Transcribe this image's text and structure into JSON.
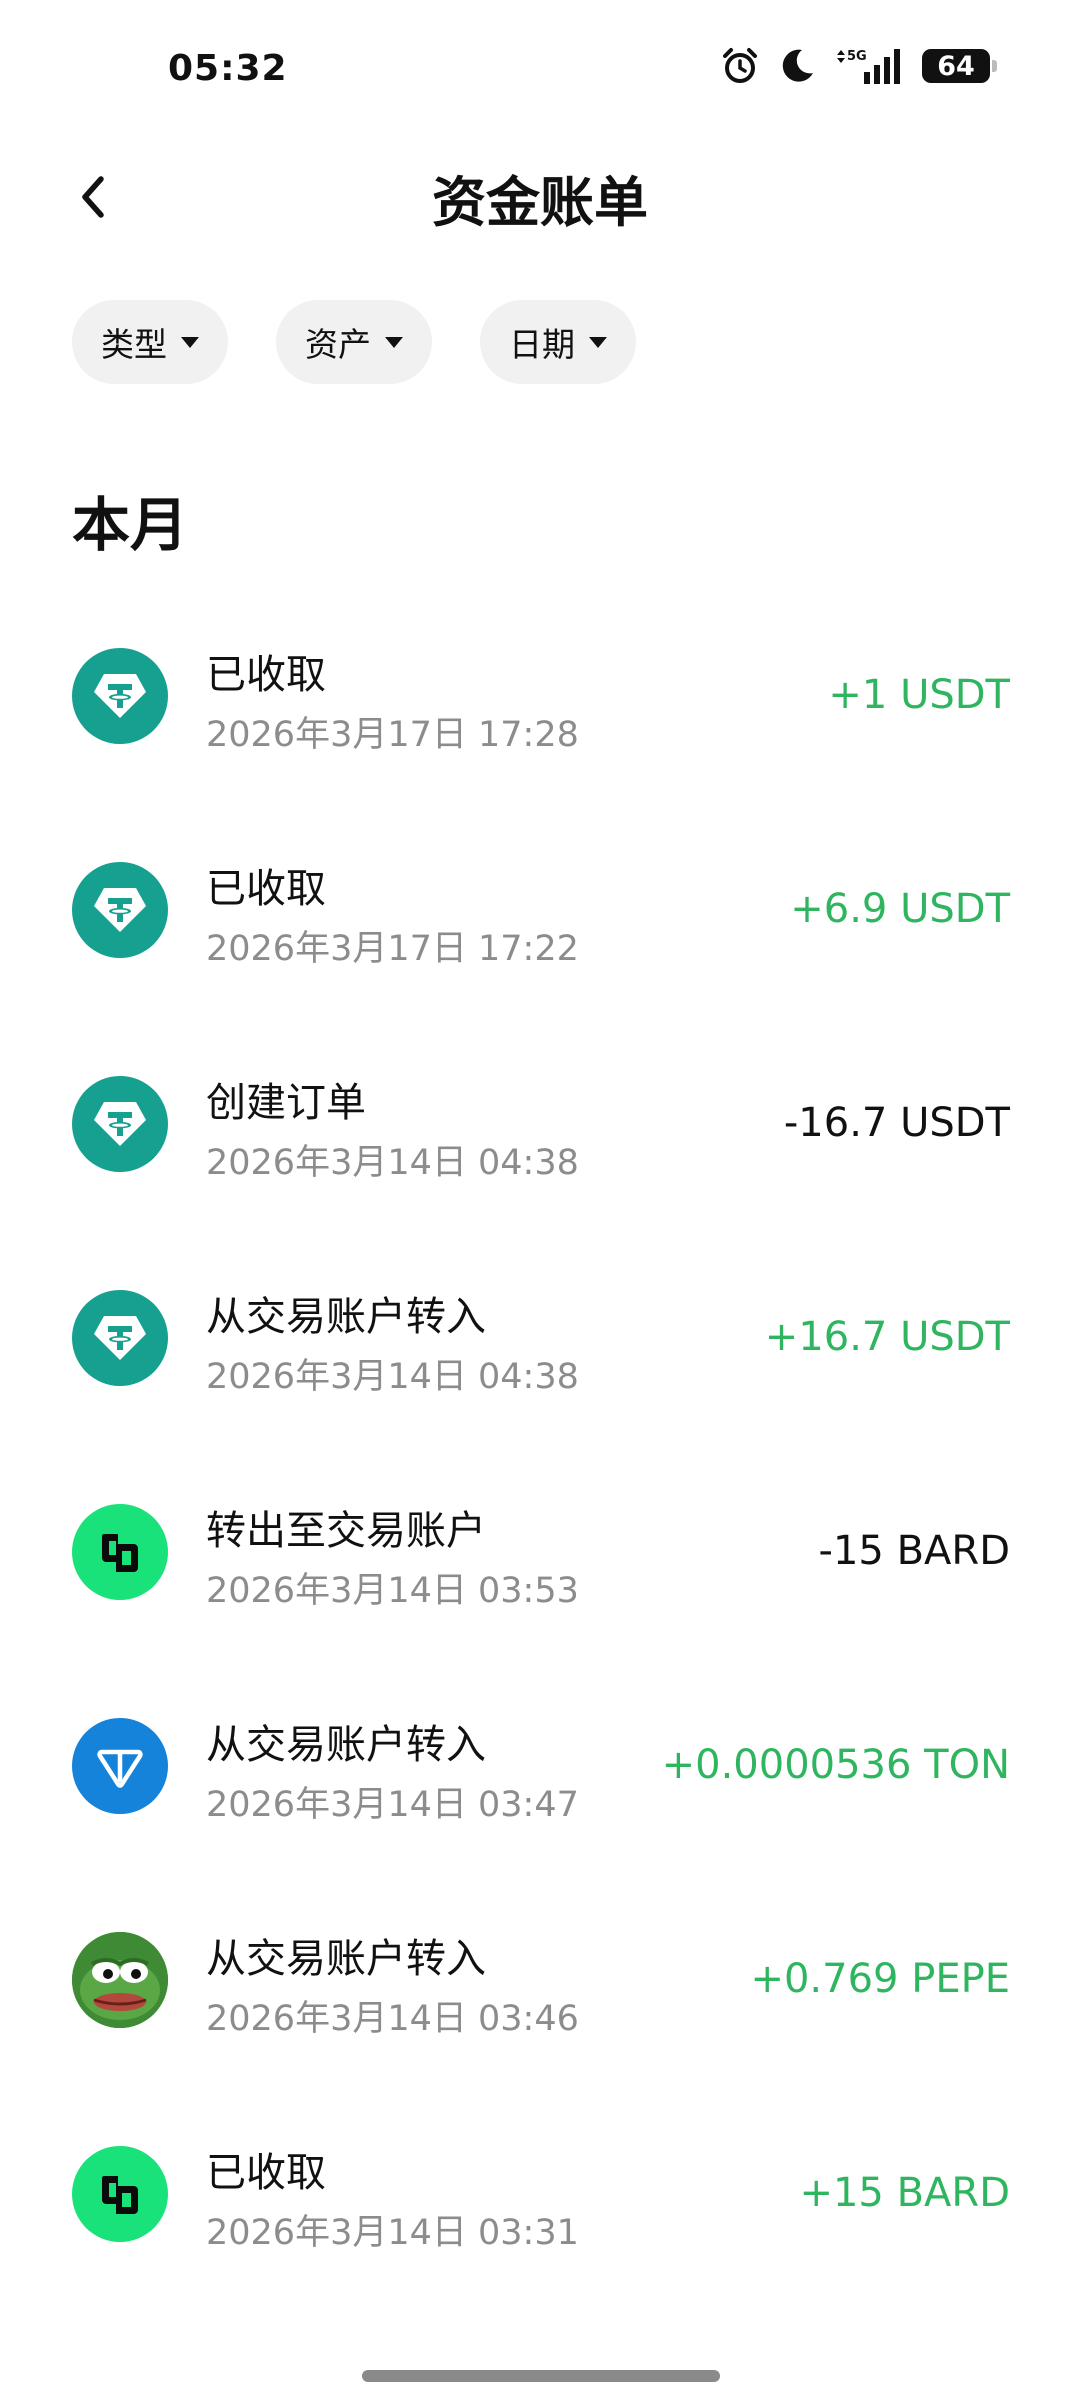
{
  "status": {
    "time": "05:32",
    "network": "5G",
    "battery": "64"
  },
  "header": {
    "title": "资金账单"
  },
  "filters": [
    {
      "label": "类型"
    },
    {
      "label": "资产"
    },
    {
      "label": "日期"
    }
  ],
  "section": {
    "title": "本月"
  },
  "transactions": [
    {
      "title": "已收取",
      "time": "2026年3月17日 17:28",
      "amount": "+1 USDT",
      "direction": "in",
      "icon": "usdt-icon"
    },
    {
      "title": "已收取",
      "time": "2026年3月17日 17:22",
      "amount": "+6.9 USDT",
      "direction": "in",
      "icon": "usdt-icon"
    },
    {
      "title": "创建订单",
      "time": "2026年3月14日 04:38",
      "amount": "-16.7 USDT",
      "direction": "out",
      "icon": "usdt-icon"
    },
    {
      "title": "从交易账户转入",
      "time": "2026年3月14日 04:38",
      "amount": "+16.7 USDT",
      "direction": "in",
      "icon": "usdt-icon"
    },
    {
      "title": "转出至交易账户",
      "time": "2026年3月14日 03:53",
      "amount": "-15 BARD",
      "direction": "out",
      "icon": "bard-icon"
    },
    {
      "title": "从交易账户转入",
      "time": "2026年3月14日 03:47",
      "amount": "+0.0000536 TON",
      "direction": "in",
      "icon": "ton-icon"
    },
    {
      "title": "从交易账户转入",
      "time": "2026年3月14日 03:46",
      "amount": "+0.769 PEPE",
      "direction": "in",
      "icon": "pepe-icon"
    },
    {
      "title": "已收取",
      "time": "2026年3月14日 03:31",
      "amount": "+15 BARD",
      "direction": "in",
      "icon": "bard-icon"
    }
  ],
  "colors": {
    "positive": "#2fb55f",
    "negative": "#111111",
    "secondary_text": "#8c8c8c",
    "chip_bg": "#f1f1f1"
  }
}
